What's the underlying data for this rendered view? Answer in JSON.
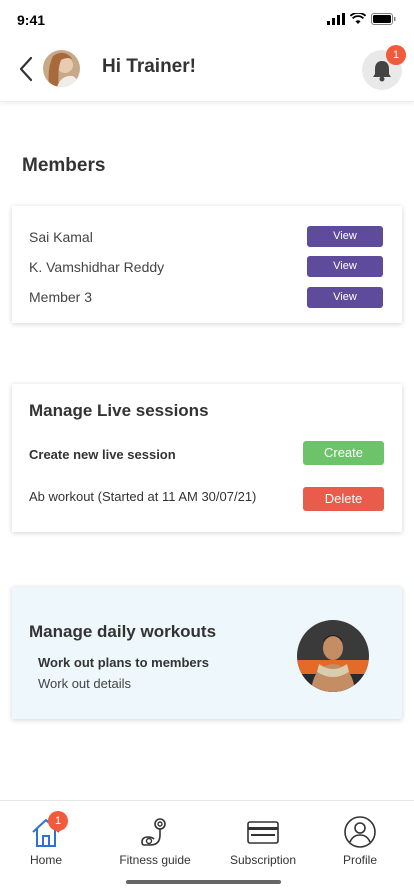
{
  "status_bar": {
    "time": "9:41"
  },
  "header": {
    "title": "Hi Trainer!",
    "notification_count": "1"
  },
  "members": {
    "title": "Members",
    "items": [
      {
        "name": "Sai Kamal",
        "action": "View"
      },
      {
        "name": "K. Vamshidhar Reddy",
        "action": "View"
      },
      {
        "name": "Member 3",
        "action": "View"
      }
    ]
  },
  "live_sessions": {
    "title": "Manage Live sessions",
    "create_label": "Create new live session",
    "create_button": "Create",
    "session_label": "Ab workout  (Started at 11 AM 30/07/21)",
    "delete_button": "Delete"
  },
  "daily_workouts": {
    "title": "Manage daily workouts",
    "subtitle": "Work out plans to members",
    "details": "Work out details"
  },
  "bottom_nav": {
    "items": [
      {
        "label": "Home",
        "icon": "home-icon",
        "badge": "1"
      },
      {
        "label": "Fitness guide",
        "icon": "fitness-icon"
      },
      {
        "label": "Subscription",
        "icon": "card-icon"
      },
      {
        "label": "Profile",
        "icon": "profile-icon"
      }
    ]
  },
  "colors": {
    "view_button": "#5f4b9b",
    "create_button": "#6cc36a",
    "delete_button": "#e95b4a",
    "badge": "#f15a3a",
    "active_nav": "#2f6fd6",
    "workout_card_bg": "#eef7fb"
  }
}
